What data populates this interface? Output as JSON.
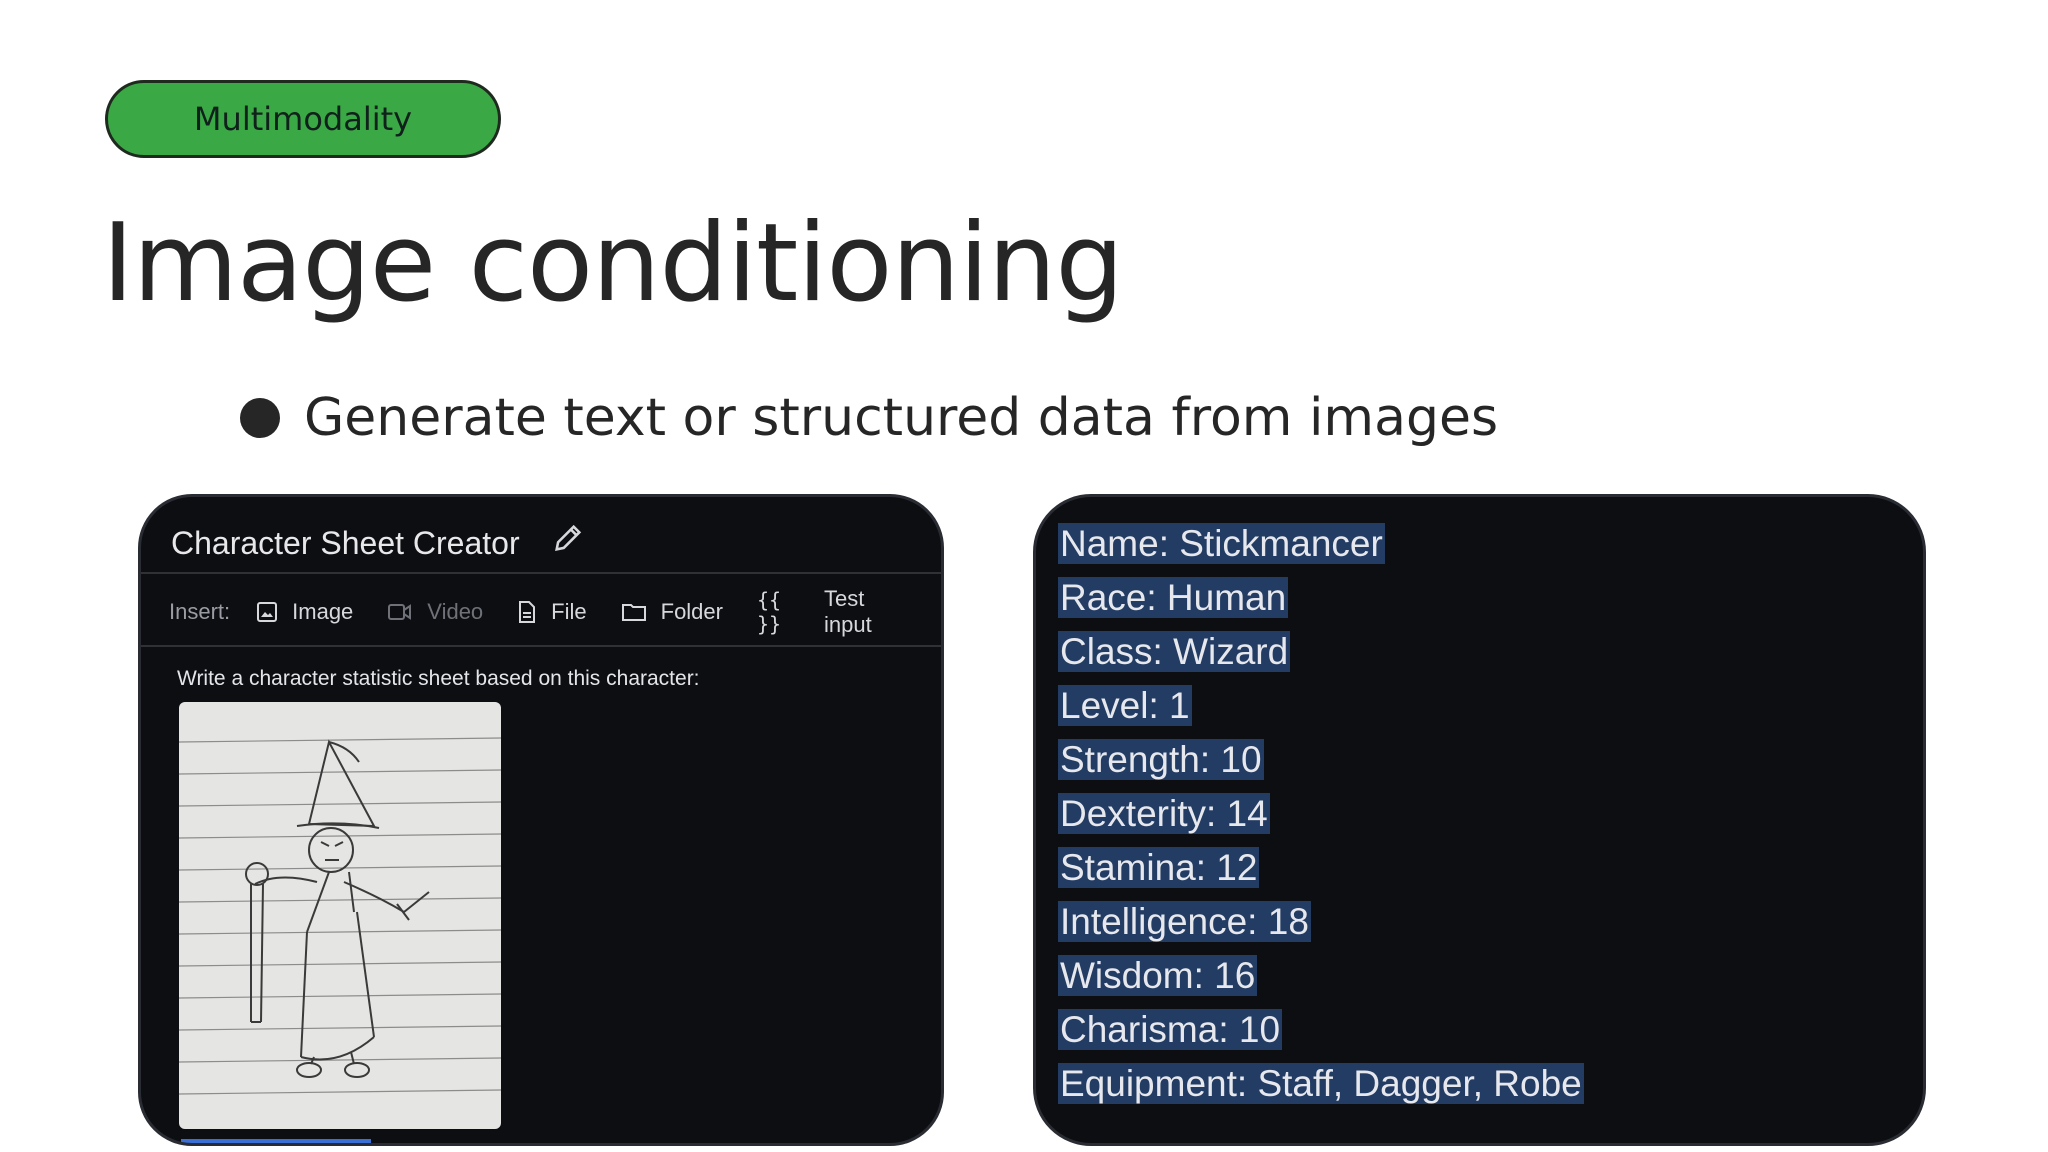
{
  "slide": {
    "tag": "Multimodality",
    "title": "Image conditioning",
    "bullet": "Generate text or structured data from images"
  },
  "left_panel": {
    "title": "Character Sheet Creator",
    "insert_label": "Insert:",
    "toolbar": [
      {
        "label": "Image",
        "icon": "image-icon",
        "enabled": true
      },
      {
        "label": "Video",
        "icon": "video-icon",
        "enabled": false
      },
      {
        "label": "File",
        "icon": "file-icon",
        "enabled": true
      },
      {
        "label": "Folder",
        "icon": "folder-icon",
        "enabled": true
      },
      {
        "label": "Test input",
        "icon": "braces-icon",
        "enabled": true
      }
    ],
    "prompt": "Write a character statistic sheet based on this character:",
    "image": "wizard-stick-figure-sketch"
  },
  "right_panel": {
    "stats": [
      "Name: Stickmancer",
      "Race: Human",
      "Class: Wizard",
      "Level: 1",
      "Strength: 10",
      "Dexterity: 14",
      "Stamina: 12",
      "Intelligence: 18",
      "Wisdom: 16",
      "Charisma: 10",
      "Equipment: Staff, Dagger, Robe"
    ]
  },
  "colors": {
    "tag_fill": "#3ba846",
    "panel_bg": "#0d0e12",
    "highlight": "#233c63"
  }
}
